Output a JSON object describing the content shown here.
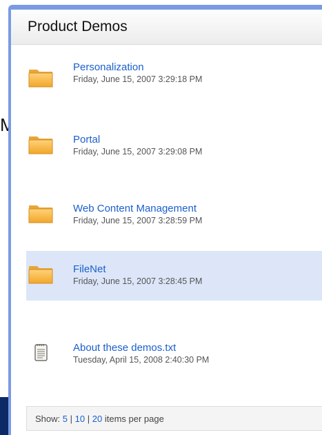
{
  "background": {
    "partial_text": "M"
  },
  "panel": {
    "title": "Product Demos",
    "accent_color": "#7a9be4",
    "link_color": "#1a5fcc",
    "selected_row_color": "#dce6f8"
  },
  "items": [
    {
      "type": "folder",
      "name": "Personalization",
      "date": "Friday, June 15, 2007 3:29:18 PM",
      "selected": false
    },
    {
      "type": "folder",
      "name": "Portal",
      "date": "Friday, June 15, 2007 3:29:08 PM",
      "selected": false
    },
    {
      "type": "folder",
      "name": "Web Content Management",
      "date": "Friday, June 15, 2007 3:28:59 PM",
      "selected": false
    },
    {
      "type": "folder",
      "name": "FileNet",
      "date": "Friday, June 15, 2007 3:28:45 PM",
      "selected": true
    },
    {
      "type": "text-file",
      "name": "About these demos.txt",
      "date": "Tuesday, April 15, 2008 2:40:30 PM",
      "selected": false
    }
  ],
  "footer": {
    "show_label": "Show:",
    "options": [
      "5",
      "10",
      "20"
    ],
    "separator": "|",
    "suffix": "items per page"
  }
}
